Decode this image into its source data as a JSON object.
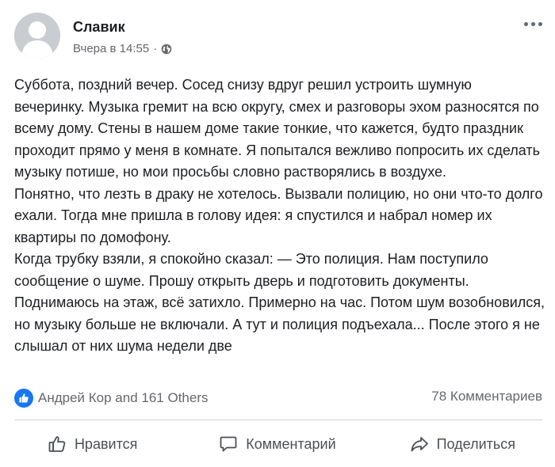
{
  "post": {
    "author": "Славик",
    "timestamp": "Вчера в 14:55",
    "separator": "·",
    "privacy_icon": "globe-icon",
    "menu_icon": "more-horizontal-icon",
    "paragraphs": [
      "Суббота, поздний вечер. Сосед снизу вдруг решил устроить шумную вечеринку. Музыка гремит на всю округу, смех и разговоры эхом разносятся по всему дому. Стены в нашем доме такие тонкие, что кажется, будто праздник проходит прямо у меня в комнате. Я попытался вежливо попросить их сделать музыку потише, но мои просьбы словно растворялись в воздухе.",
      "Понятно, что лезть в драку не хотелось. Вызвали полицию, но они что-то долго ехали. Тогда мне пришла в голову идея: я спустился и набрал номер их квартиры по домофону.",
      "Когда трубку взяли, я спокойно сказал: — Это полиция. Нам поступило сообщение о шуме. Прошу открыть дверь и подготовить документы. Поднимаюсь на этаж, всё затихло. Примерно на час. Потом шум возобновился, но музыку больше не включали. А тут и полиция подъехала... После этого я не слышал от них шума недели две"
    ]
  },
  "reactions": {
    "icon": "like-reaction-icon",
    "text": "Андрей Кор and 161 Others",
    "comments": "78 Комментариев"
  },
  "actions": {
    "like": "Нравится",
    "comment": "Комментарий",
    "share": "Поделиться"
  },
  "colors": {
    "accent": "#1877f2",
    "secondary_text": "#65676b",
    "primary_text": "#1c1e21"
  }
}
